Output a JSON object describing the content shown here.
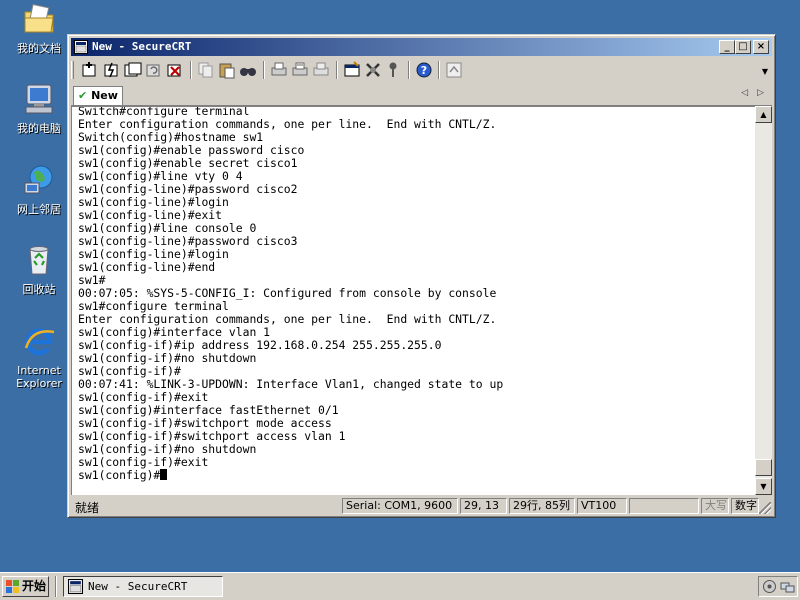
{
  "desktop": {
    "icons": [
      {
        "label": "我的文档",
        "icon": "my-documents-icon"
      },
      {
        "label": "我的电脑",
        "icon": "my-computer-icon"
      },
      {
        "label": "网上邻居",
        "icon": "network-places-icon"
      },
      {
        "label": "回收站",
        "icon": "recycle-bin-icon"
      },
      {
        "label_line1": "Internet",
        "label_line2": "Explorer",
        "icon": "internet-explorer-icon"
      }
    ],
    "background_color": "#3a6ea5"
  },
  "window": {
    "title": "New - SecureCRT",
    "controls": {
      "minimize": "_",
      "maximize": "□",
      "close": "×"
    },
    "toolbar_icons": [
      "connect-icon",
      "quick-connect-icon",
      "connect-in-tab-icon",
      "reconnect-icon",
      "disconnect-icon",
      "copy-icon",
      "paste-icon",
      "find-icon",
      "print-icon",
      "print-selection-icon",
      "print-setup-icon",
      "session-options-icon",
      "global-options-icon",
      "key-map-icon",
      "help-icon",
      "sftp-icon"
    ],
    "tab": {
      "label": "New",
      "check": "✔"
    },
    "tab_nav": {
      "prev": "◁",
      "next": "▷"
    },
    "terminal": {
      "lines": [
        "Switch#configure terminal",
        "Enter configuration commands, one per line.  End with CNTL/Z.",
        "Switch(config)#hostname sw1",
        "sw1(config)#enable password cisco",
        "sw1(config)#enable secret cisco1",
        "sw1(config)#line vty 0 4",
        "sw1(config-line)#password cisco2",
        "sw1(config-line)#login",
        "sw1(config-line)#exit",
        "sw1(config)#line console 0",
        "sw1(config-line)#password cisco3",
        "sw1(config-line)#login",
        "sw1(config-line)#end",
        "sw1#",
        "00:07:05: %SYS-5-CONFIG_I: Configured from console by console",
        "sw1#configure terminal",
        "Enter configuration commands, one per line.  End with CNTL/Z.",
        "sw1(config)#interface vlan 1",
        "sw1(config-if)#ip address 192.168.0.254 255.255.255.0",
        "sw1(config-if)#no shutdown",
        "sw1(config-if)#",
        "00:07:41: %LINK-3-UPDOWN: Interface Vlan1, changed state to up",
        "sw1(config-if)#exit",
        "sw1(config)#interface fastEthernet 0/1",
        "sw1(config-if)#switchport mode access",
        "sw1(config-if)#switchport access vlan 1",
        "sw1(config-if)#no shutdown",
        "sw1(config-if)#exit"
      ],
      "prompt": "sw1(config)#"
    },
    "scrollbar": {
      "up": "▲",
      "down": "▼"
    },
    "statusbar": {
      "ready": "就绪",
      "serial": "Serial: COM1, 9600",
      "cursor_pos": "29, 13",
      "rows_cols": "29行, 85列",
      "emulation": "VT100",
      "empty": "",
      "caps": "大写",
      "num": "数字"
    }
  },
  "taskbar": {
    "start_label": "开始",
    "task_title": "New - SecureCRT",
    "tray_icons": [
      "volume-icon",
      "network-tray-icon"
    ]
  }
}
